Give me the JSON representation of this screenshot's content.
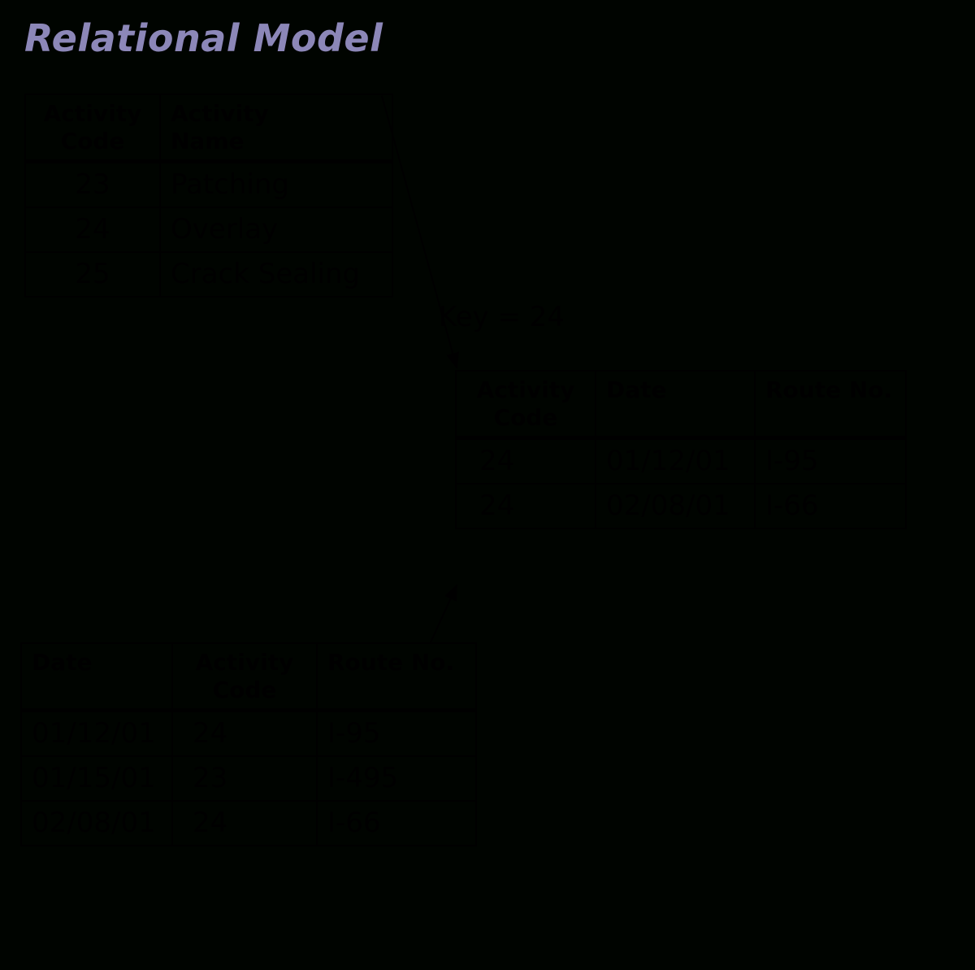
{
  "title": "Relational Model",
  "key_label": "Key = 24",
  "tables": {
    "activity": {
      "headers": {
        "code": "Activity\nCode",
        "name": "Activity\nName"
      },
      "rows": [
        {
          "code": "23",
          "name": "Patching"
        },
        {
          "code": "24",
          "name": "Overlay"
        },
        {
          "code": "25",
          "name": "Crack Sealing"
        }
      ]
    },
    "log": {
      "headers": {
        "date": "Date",
        "code": "Activity\nCode",
        "route": "Route No."
      },
      "rows": [
        {
          "date": "01/12/01",
          "code": "24",
          "route": "I-95"
        },
        {
          "date": "01/15/01",
          "code": "23",
          "route": "I-495"
        },
        {
          "date": "02/08/01",
          "code": "24",
          "route": "I-66"
        }
      ]
    },
    "result": {
      "headers": {
        "code": "Activity\nCode",
        "date": "Date",
        "route": "Route No."
      },
      "rows": [
        {
          "code": "24",
          "date": "01/12/01",
          "route": "I-95"
        },
        {
          "code": "24",
          "date": "02/08/01",
          "route": "I-66"
        }
      ]
    }
  }
}
